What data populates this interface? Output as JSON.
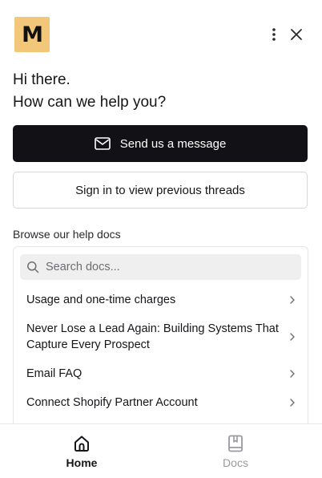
{
  "header": {
    "logo_letter": "M",
    "logo_color": "#f2c77a",
    "more_icon": "vertical-dots-icon",
    "close_icon": "close-icon"
  },
  "greeting": {
    "line1": "Hi there.",
    "line2": "How can we help you?"
  },
  "actions": {
    "send_message_label": "Send us a message",
    "send_message_icon": "envelope-icon",
    "sign_in_label": "Sign in to view previous threads",
    "primary_color": "#121216"
  },
  "docs": {
    "section_label": "Browse our help docs",
    "search_placeholder": "Search docs...",
    "items": [
      {
        "title": "Usage and one-time charges"
      },
      {
        "title": "Never Lose a Lead Again: Building Systems That Capture Every Prospect"
      },
      {
        "title": "Email FAQ"
      },
      {
        "title": "Connect Shopify Partner Account"
      }
    ]
  },
  "nav": {
    "tabs": [
      {
        "label": "Home",
        "icon": "home-icon",
        "active": true
      },
      {
        "label": "Docs",
        "icon": "book-icon",
        "active": false
      }
    ]
  }
}
